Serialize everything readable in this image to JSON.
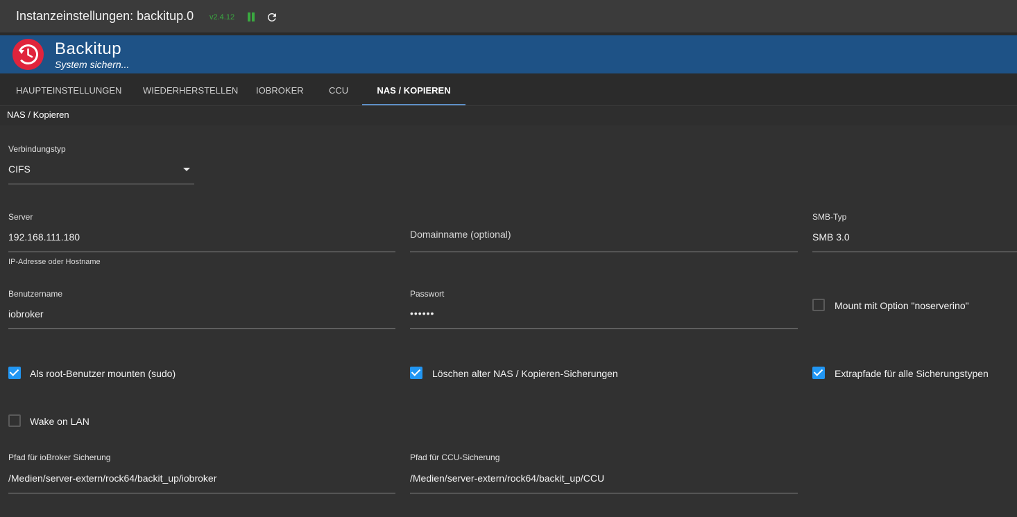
{
  "topbar": {
    "title": "Instanzeinstellungen: backitup.0",
    "version": "v2.4.12"
  },
  "header": {
    "name": "Backitup",
    "slogan": "System sichern..."
  },
  "tabs": [
    {
      "label": "HAUPTEINSTELLUNGEN"
    },
    {
      "label": "WIEDERHERSTELLEN"
    },
    {
      "label": "IOBROKER"
    },
    {
      "label": "CCU"
    },
    {
      "label": "NAS / KOPIEREN"
    }
  ],
  "active_tab": "NAS / KOPIEREN",
  "section_title": "NAS / Kopieren",
  "form": {
    "connection_type": {
      "label": "Verbindungstyp",
      "value": "CIFS"
    },
    "server": {
      "label": "Server",
      "value": "192.168.111.180",
      "helper": "IP-Adresse oder Hostname"
    },
    "domain": {
      "placeholder": "Domainname (optional)",
      "value": ""
    },
    "smb_type": {
      "label": "SMB-Typ",
      "value": "SMB 3.0"
    },
    "username": {
      "label": "Benutzername",
      "value": "iobroker"
    },
    "password": {
      "label": "Passwort",
      "value": "••••••"
    },
    "noserverino": {
      "label": "Mount mit Option \"noserverino\"",
      "checked": false
    },
    "sudo": {
      "label": "Als root-Benutzer mounten (sudo)",
      "checked": true
    },
    "delete_old": {
      "label": "Löschen alter NAS / Kopieren-Sicherungen",
      "checked": true
    },
    "extra_paths": {
      "label": "Extrapfade für alle Sicherungstypen",
      "checked": true
    },
    "wake_on_lan": {
      "label": "Wake on LAN",
      "checked": false
    },
    "iobroker_path": {
      "label": "Pfad für ioBroker Sicherung",
      "value": "/Medien/server-extern/rock64/backit_up/iobroker"
    },
    "ccu_path": {
      "label": "Pfad für CCU-Sicherung",
      "value": "/Medien/server-extern/rock64/backit_up/CCU"
    }
  },
  "colors": {
    "header_bg": "#1e5286",
    "logo_red": "#e0243c",
    "checkbox_blue": "#2196f3",
    "status_green": "#3aa940"
  }
}
